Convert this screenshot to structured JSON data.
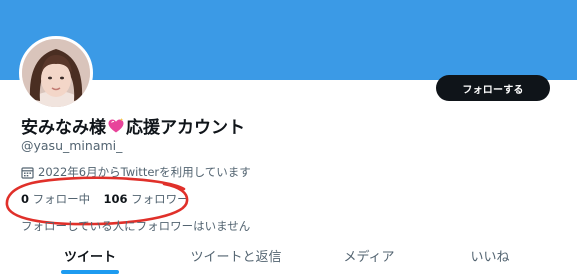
{
  "profile": {
    "display_name_prefix": "安みなみ様",
    "heart_icon": "sparkling-heart-icon",
    "display_name_suffix": "応援アカウント",
    "handle": "@yasu_minami_",
    "joined": "2022年6月からTwitterを利用しています",
    "follow_button_label": "フォローする",
    "following_count": "0",
    "following_label": "フォロー中",
    "followers_count": "106",
    "followers_label": "フォロワー",
    "mutuals_note": "フォローしている人にフォロワーはいません"
  },
  "tabs": [
    {
      "label": "ツイート",
      "active": true
    },
    {
      "label": "ツイートと返信",
      "active": false
    },
    {
      "label": "メディア",
      "active": false
    },
    {
      "label": "いいね",
      "active": false
    }
  ],
  "colors": {
    "banner": "#3b9ae6",
    "accent": "#1d9bf0",
    "annotation": "#e0302a"
  }
}
